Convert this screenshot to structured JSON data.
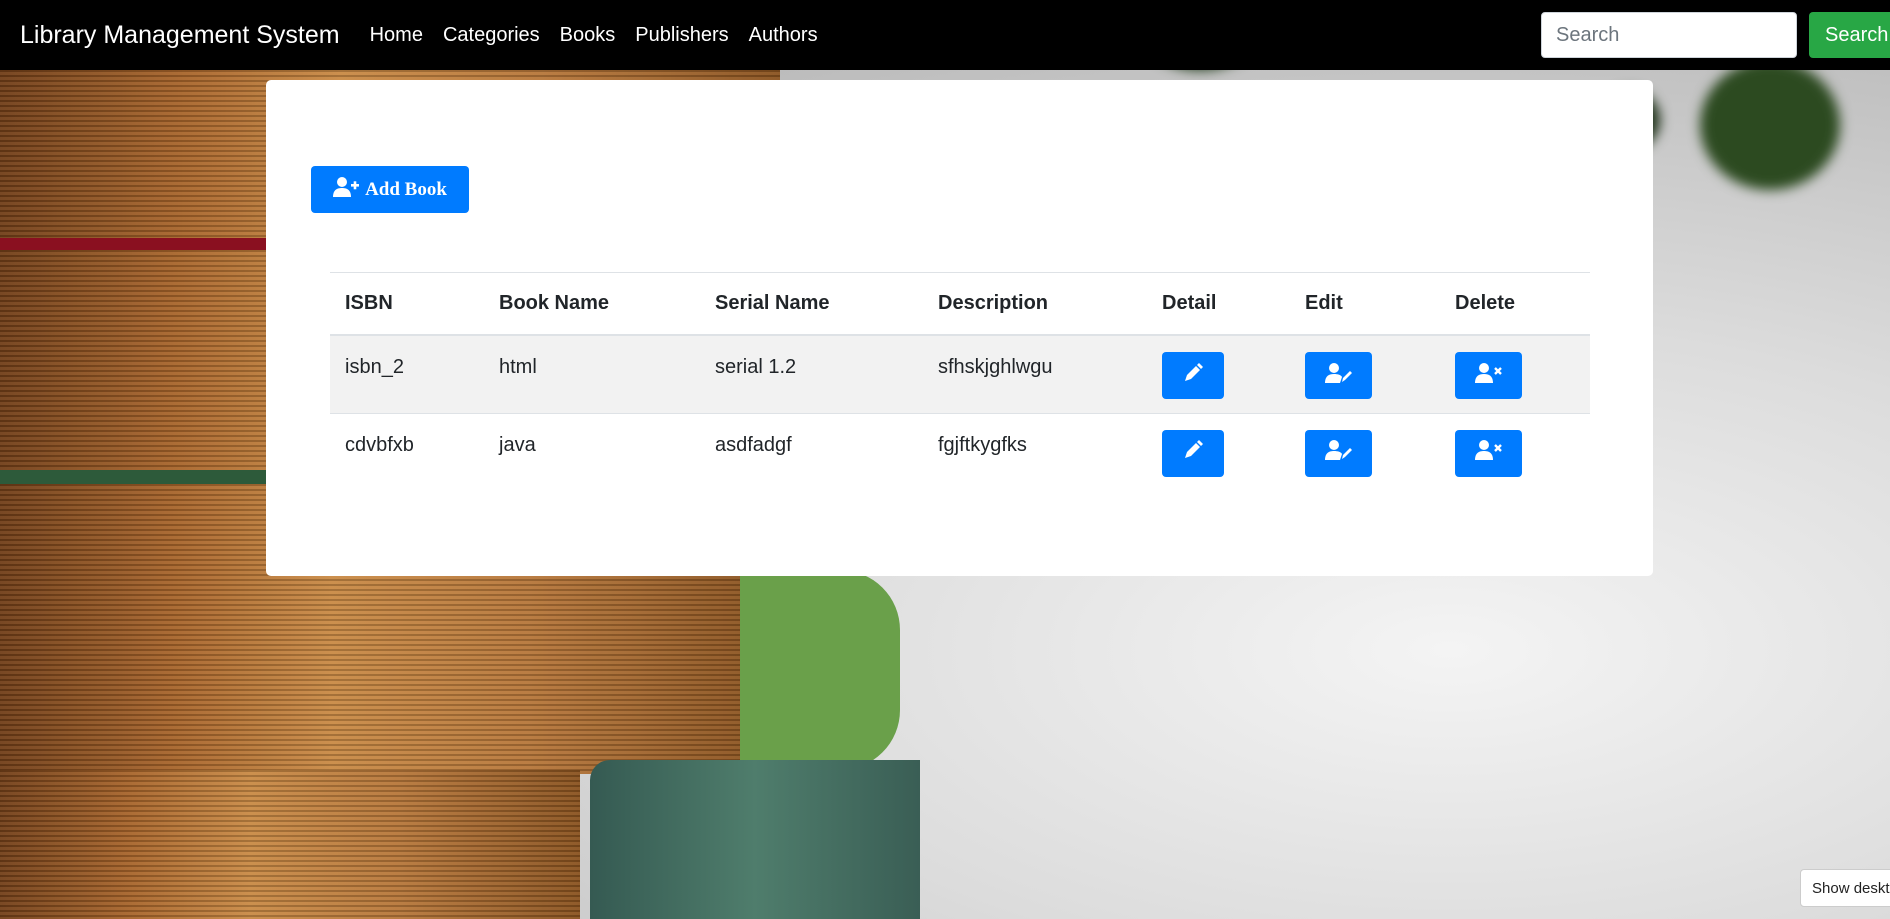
{
  "navbar": {
    "brand": "Library Management System",
    "links": [
      "Home",
      "Categories",
      "Books",
      "Publishers",
      "Authors"
    ],
    "search_placeholder": "Search",
    "search_button": "Search"
  },
  "main": {
    "add_button": "Add Book",
    "table": {
      "headers": [
        "ISBN",
        "Book Name",
        "Serial Name",
        "Description",
        "Detail",
        "Edit",
        "Delete"
      ],
      "rows": [
        {
          "isbn": "isbn_2",
          "book_name": "html",
          "serial_name": "serial 1.2",
          "description": "sfhskjghlwgu"
        },
        {
          "isbn": "cdvbfxb",
          "book_name": "java",
          "serial_name": "asdfadgf",
          "description": "fgjftkygfks"
        }
      ]
    }
  },
  "footer": {
    "desktop_button": "Show desktop"
  },
  "colors": {
    "primary": "#007bff",
    "success": "#28a745",
    "navbar": "#000000",
    "stripe": "#f2f2f2"
  },
  "icons": [
    "user-plus-icon",
    "pen-icon",
    "user-edit-icon",
    "user-times-icon"
  ]
}
